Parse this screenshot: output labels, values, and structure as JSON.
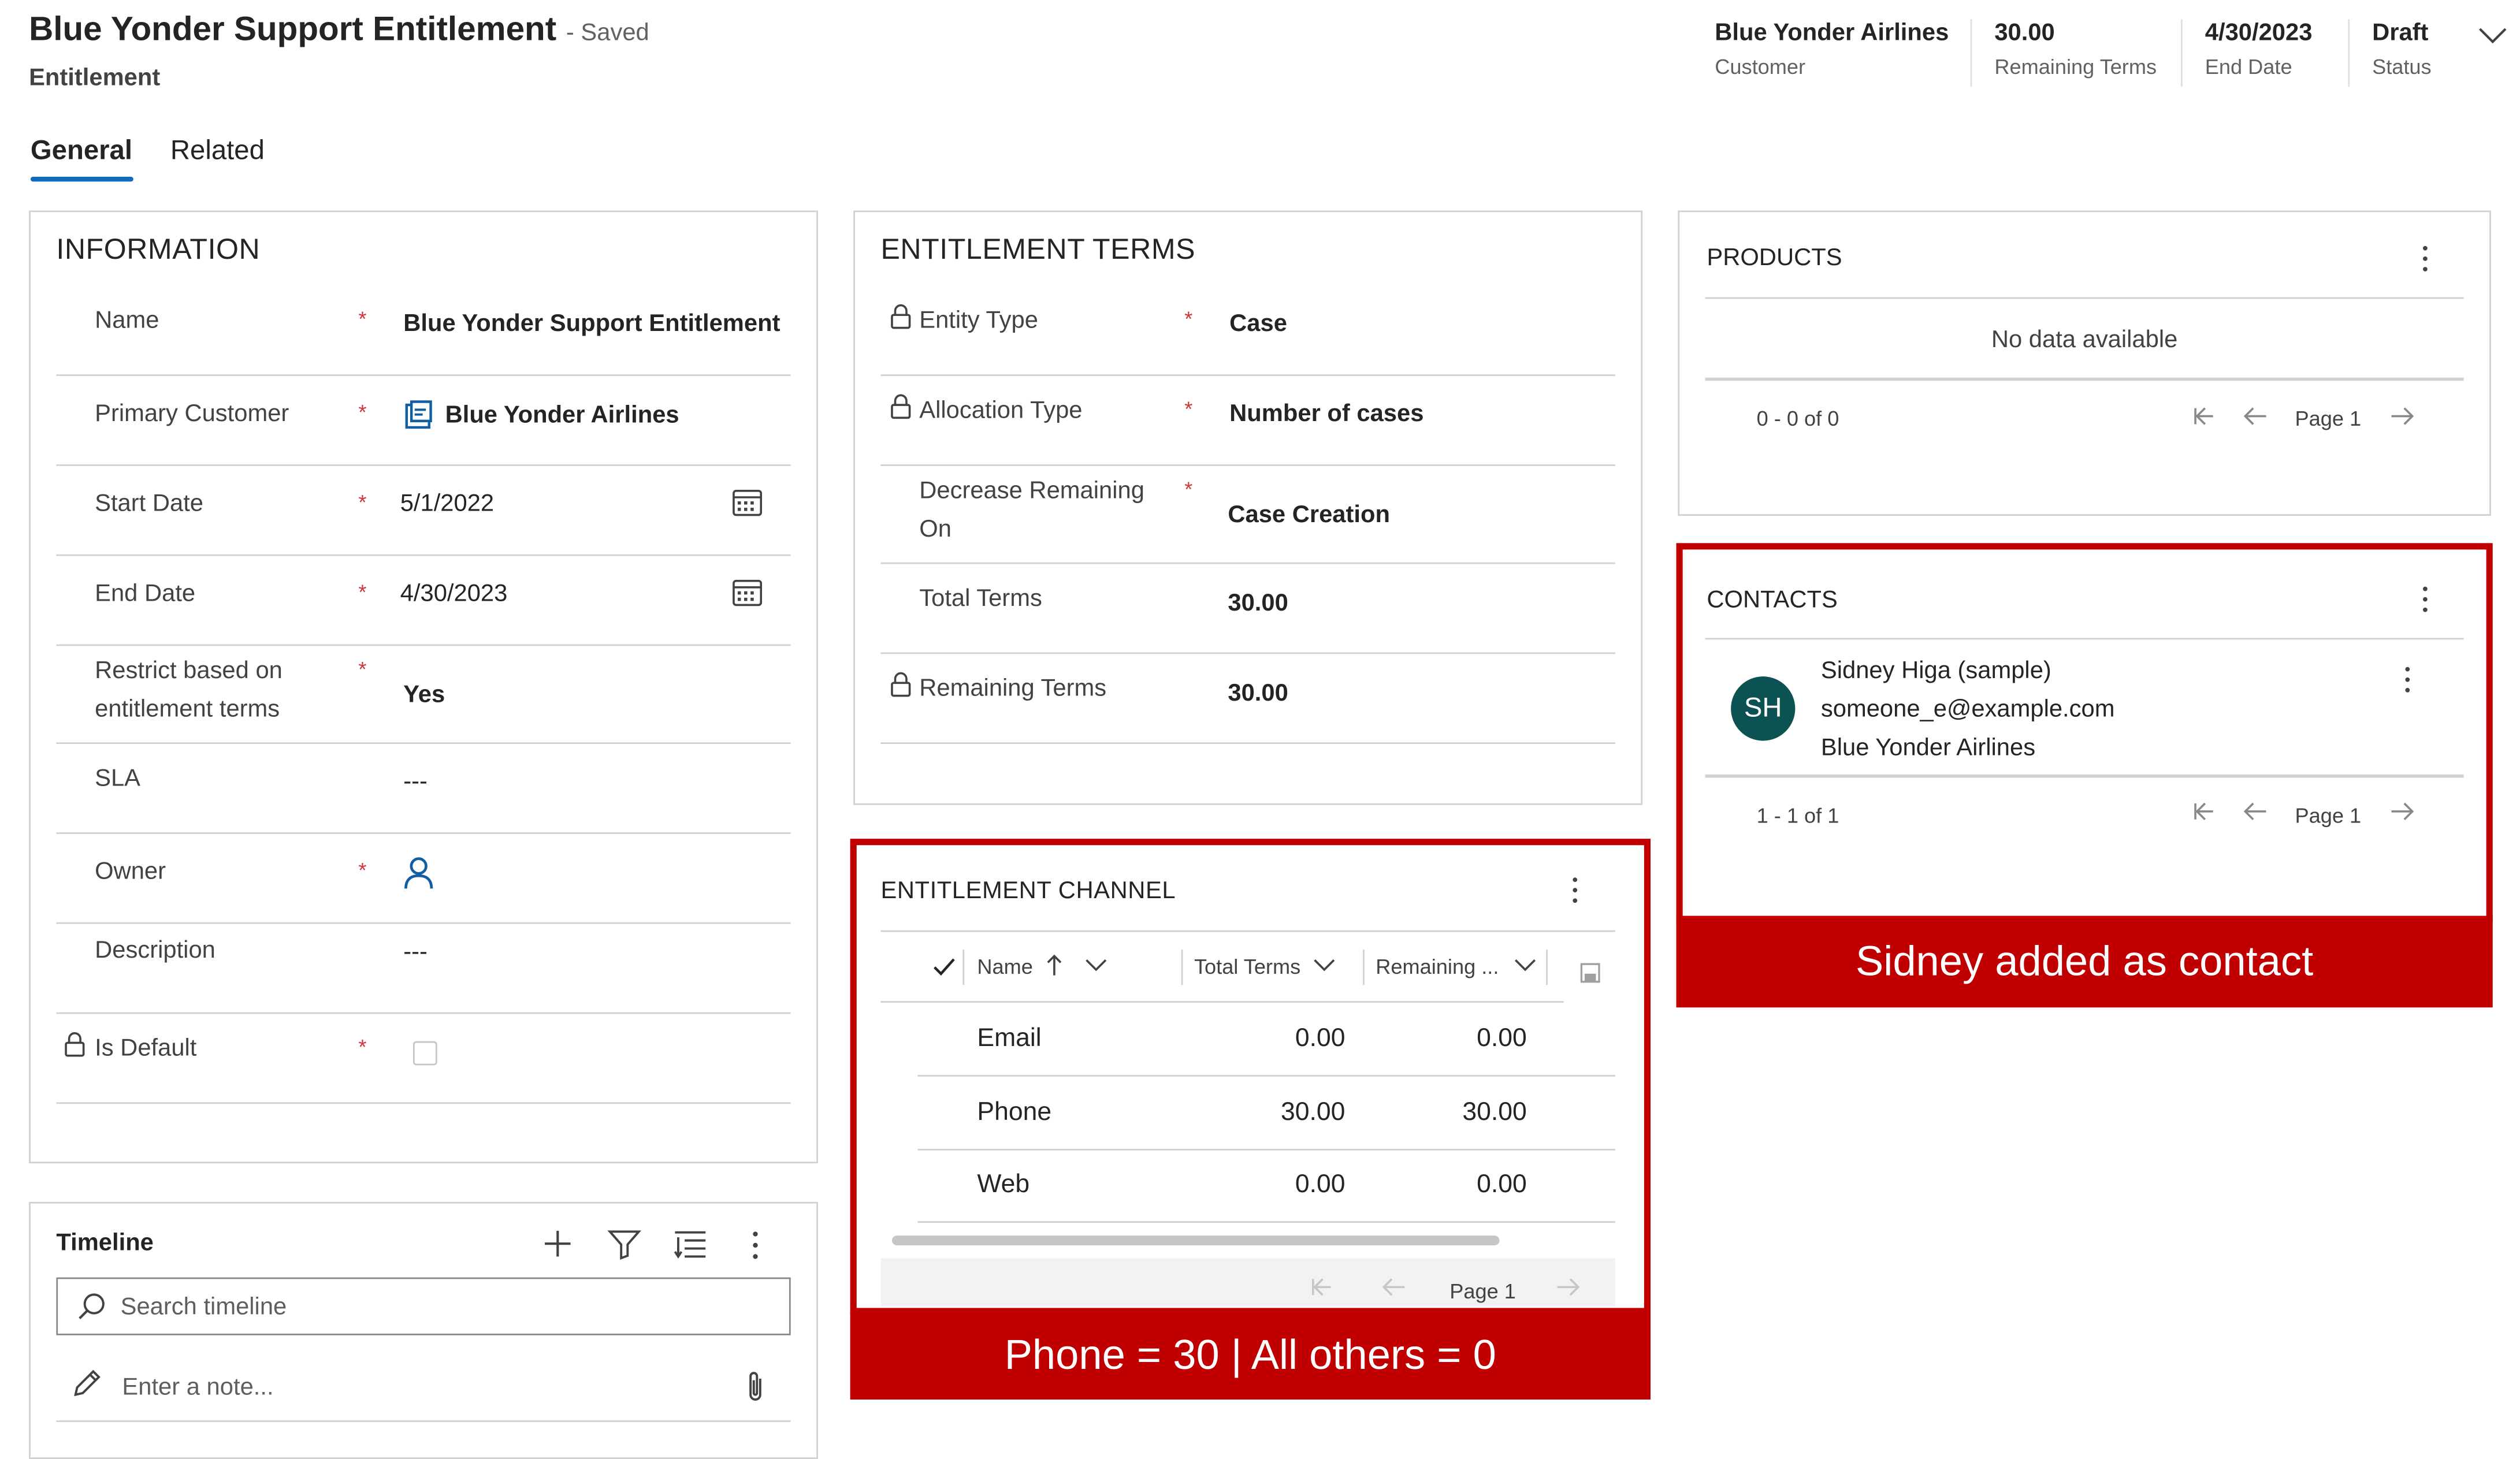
{
  "header": {
    "title": "Blue Yonder Support Entitlement",
    "saved": "- Saved",
    "entity": "Entitlement",
    "fields": [
      {
        "value": "Blue Yonder Airlines",
        "label": "Customer"
      },
      {
        "value": "30.00",
        "label": "Remaining Terms"
      },
      {
        "value": "4/30/2023",
        "label": "End Date"
      },
      {
        "value": "Draft",
        "label": "Status"
      }
    ]
  },
  "tabs": [
    {
      "label": "General"
    },
    {
      "label": "Related"
    }
  ],
  "information": {
    "title": "INFORMATION",
    "fields": [
      {
        "label": "Name",
        "value": "Blue Yonder Support Entitlement"
      },
      {
        "label": "Primary Customer",
        "value": "Blue Yonder Airlines"
      },
      {
        "label": "Start Date",
        "value": "5/1/2022"
      },
      {
        "label": "End Date",
        "value": "4/30/2023"
      },
      {
        "label": "Restrict based on entitlement terms",
        "value": "Yes"
      },
      {
        "label": "SLA",
        "value": "---"
      },
      {
        "label": "Owner",
        "value": ""
      },
      {
        "label": "Description",
        "value": "---"
      },
      {
        "label": "Is Default",
        "value": ""
      }
    ],
    "required_mark": "*"
  },
  "terms": {
    "title": "ENTITLEMENT TERMS",
    "fields": [
      {
        "label": "Entity Type",
        "value": "Case"
      },
      {
        "label": "Allocation Type",
        "value": "Number of cases"
      },
      {
        "label": "Decrease Remaining On",
        "value": "Case Creation"
      },
      {
        "label": "Total Terms",
        "value": "30.00"
      },
      {
        "label": "Remaining Terms",
        "value": "30.00"
      }
    ]
  },
  "channel": {
    "title": "ENTITLEMENT CHANNEL",
    "columns": [
      "Name",
      "Total Terms",
      "Remaining ..."
    ],
    "rows": [
      {
        "name": "Email",
        "total": "0.00",
        "remaining": "0.00"
      },
      {
        "name": "Phone",
        "total": "30.00",
        "remaining": "30.00"
      },
      {
        "name": "Web",
        "total": "0.00",
        "remaining": "0.00"
      }
    ],
    "page": "Page 1",
    "callout": "Phone = 30 | All others = 0"
  },
  "products": {
    "title": "PRODUCTS",
    "empty": "No data available",
    "range": "0 - 0 of 0",
    "page": "Page 1"
  },
  "contacts": {
    "title": "CONTACTS",
    "contact": {
      "initials": "SH",
      "name": "Sidney Higa (sample)",
      "email": "someone_e@example.com",
      "company": "Blue Yonder Airlines"
    },
    "range": "1 - 1 of 1",
    "page": "Page 1",
    "callout": "Sidney added as contact"
  },
  "timeline": {
    "title": "Timeline",
    "search_placeholder": "Search timeline",
    "note_placeholder": "Enter a note..."
  },
  "colors": {
    "accent": "#0f6cbd",
    "link": "#115ea3",
    "callout": "#c00000",
    "required": "#d13438",
    "avatar": "#0c5253"
  }
}
